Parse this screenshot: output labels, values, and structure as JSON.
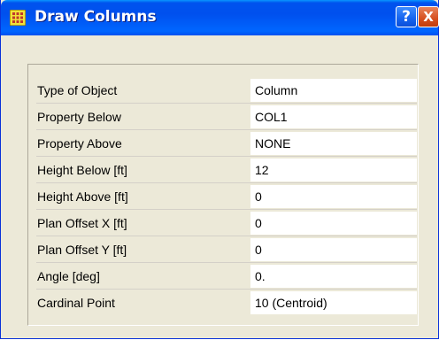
{
  "window": {
    "title": "Draw Columns",
    "title_icon": "grid-icon",
    "help_label": "?",
    "close_label": "X"
  },
  "properties": [
    {
      "label": "Type of Object",
      "value": "Column"
    },
    {
      "label": "Property Below",
      "value": "COL1"
    },
    {
      "label": "Property Above",
      "value": "NONE"
    },
    {
      "label": "Height Below  [ft]",
      "value": "12"
    },
    {
      "label": "Height Above  [ft]",
      "value": "0"
    },
    {
      "label": "Plan Offset X  [ft]",
      "value": "0"
    },
    {
      "label": "Plan Offset Y  [ft]",
      "value": "0"
    },
    {
      "label": "Angle  [deg]",
      "value": "0."
    },
    {
      "label": "Cardinal Point",
      "value": "10 (Centroid)"
    }
  ],
  "colors": {
    "titlebar": "#0054e3",
    "dialog_bg": "#ece9d8",
    "close_button": "#d6501f",
    "field_bg": "#ffffff"
  }
}
